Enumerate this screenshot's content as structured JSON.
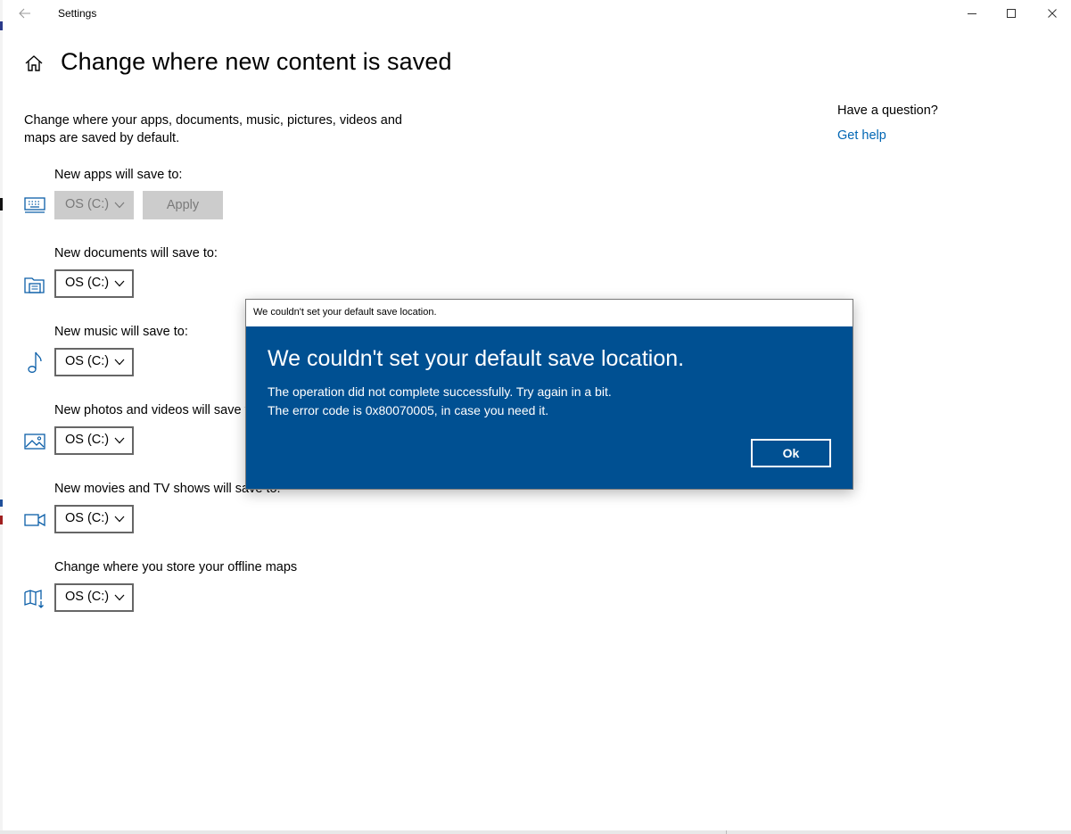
{
  "window": {
    "title": "Settings",
    "back_icon": "arrow-left-icon",
    "controls": [
      "minimize-icon",
      "maximize-icon",
      "close-icon"
    ]
  },
  "header": {
    "home_icon": "home-icon",
    "title": "Change where new content is saved"
  },
  "description": "Change where your apps, documents, music, pictures, videos and maps are saved by default.",
  "settings": [
    {
      "label": "New apps will save to:",
      "icon": "keyboard-icon",
      "value": "OS (C:)",
      "disabled": true,
      "apply_label": "Apply"
    },
    {
      "label": "New documents will save to:",
      "icon": "document-folder-icon",
      "value": "OS (C:)"
    },
    {
      "label": "New music will save to:",
      "icon": "music-note-icon",
      "value": "OS (C:)"
    },
    {
      "label": "New photos and videos will save to:",
      "icon": "picture-icon",
      "value": "OS (C:)"
    },
    {
      "label": "New movies and TV shows will save to:",
      "icon": "video-camera-icon",
      "value": "OS (C:)"
    },
    {
      "label": "Change where you store your offline maps",
      "icon": "map-download-icon",
      "value": "OS (C:)"
    }
  ],
  "side_panel": {
    "question": "Have a question?",
    "link": "Get help"
  },
  "dialog": {
    "window_title": "We couldn't set your default save location.",
    "heading": "We couldn't set your default save location.",
    "line1": "The operation did not complete successfully. Try again in a bit.",
    "line2": "The error code is 0x80070005, in case you need it.",
    "ok_label": "Ok"
  },
  "colors": {
    "dialog_bg": "#005092",
    "link": "#0066b4",
    "icon": "#0a5ea8",
    "disabled_bg": "#cccccc"
  }
}
